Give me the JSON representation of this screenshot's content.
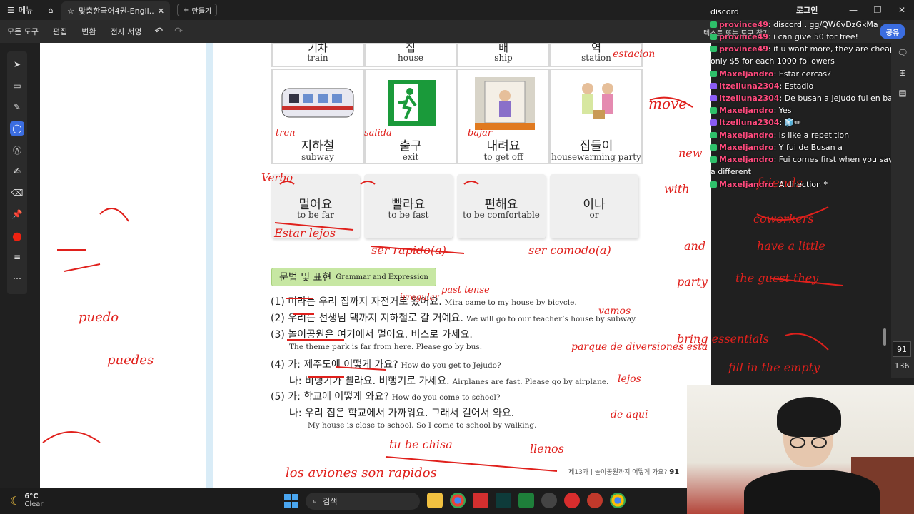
{
  "titlebar": {
    "menu_label": "메뉴",
    "tab_title": "맞춤한국어4권-Engli...",
    "new_tab_label": "만들기",
    "login_label": "로그인"
  },
  "toolbar": {
    "items": [
      "모든 도구",
      "편집",
      "변환",
      "전자 서명"
    ],
    "search_hint": "텍스트 또는 도구 찾기",
    "share_label": "공유"
  },
  "vocab_top": [
    {
      "ko": "기차",
      "en": "train"
    },
    {
      "ko": "집",
      "en": "house"
    },
    {
      "ko": "배",
      "en": "ship"
    },
    {
      "ko": "역",
      "en": "station"
    }
  ],
  "vocab_cards": [
    {
      "ko": "지하철",
      "en": "subway"
    },
    {
      "ko": "출구",
      "en": "exit"
    },
    {
      "ko": "내려요",
      "en": "to get off"
    },
    {
      "ko": "집들이",
      "en": "housewarming party"
    }
  ],
  "phrase_cards": [
    {
      "ko": "멀어요",
      "en": "to be far"
    },
    {
      "ko": "빨라요",
      "en": "to be fast"
    },
    {
      "ko": "편해요",
      "en": "to be comfortable"
    },
    {
      "ko": "이나",
      "en": "or"
    }
  ],
  "grammar": {
    "title": "문법 및 표현",
    "subtitle": "Grammar and Expression",
    "lines": [
      {
        "num": "(1)",
        "ko": "미라는 우리 집까지 자전거로 왔어요.",
        "en": "Mira came to my house by bicycle."
      },
      {
        "num": "(2)",
        "ko": "우리는 선생님 댁까지 지하철로 갈 거예요.",
        "en": "We will go to our teacher’s house by subway."
      },
      {
        "num": "(3)",
        "ko": "놀이공원은 여기에서 멀어요. 버스로 가세요.",
        "en": ""
      },
      {
        "num": "",
        "ko": "",
        "en": "The theme park is far from here.  Please go by bus."
      },
      {
        "num": "(4)",
        "ko": "가: 제주도에 어떻게 가요?",
        "en": "How do you get to Jejudo?"
      },
      {
        "num": "",
        "ko": "나: 비행기가 빨라요. 비행기로 가세요.",
        "en": "Airplanes are fast. Please go by airplane."
      },
      {
        "num": "(5)",
        "ko": "가: 학교에 어떻게 와요?",
        "en": "How do you come to school?"
      },
      {
        "num": "",
        "ko": "나: 우리 집은 학교에서 가까워요. 그래서 걸어서 와요.",
        "en": ""
      },
      {
        "num": "",
        "ko": "",
        "en": "My house is close to school.  So I come to school by walking."
      }
    ],
    "footer_text": "제13과 | 놀이공원까지 어떻게 가요?",
    "footer_page": "91"
  },
  "handwriting": {
    "annotations": [
      "Verbo",
      "Estar lejos",
      "ser rapido(a)",
      "ser comodo(a)",
      "tren",
      "salida",
      "bajar",
      "estacion",
      "move",
      "new",
      "with",
      "friends",
      "coworkers",
      "have a little",
      "the guest they",
      "and",
      "party",
      "bring essentials",
      "fill in the empty",
      "parque de diversiones esta",
      "lejos",
      "de aqui",
      "puedo",
      "puedes",
      "tu be chisa",
      "los aviones son rapidos",
      "llenos",
      "past tense",
      "irregular",
      "vamos"
    ]
  },
  "chat": {
    "messages": [
      {
        "user": "",
        "text": "discord",
        "badge": "none"
      },
      {
        "user": "province49",
        "text": "discord . gg/QW6vDzGkMa",
        "badge": "g"
      },
      {
        "user": "province49",
        "text": "i can give 50 for free!",
        "badge": "g"
      },
      {
        "user": "province49",
        "text": "if u want more, they are cheap! only $5 for each 1000 followers",
        "badge": "g"
      },
      {
        "user": "Maxeljandro",
        "text": "Estar cercas?",
        "badge": "g"
      },
      {
        "user": "Itzelluna2304",
        "text": "Estadio",
        "badge": "p"
      },
      {
        "user": "Itzelluna2304",
        "text": "De busan a jejudo fui en barco",
        "badge": "p"
      },
      {
        "user": "Maxeljandro",
        "text": "Yes",
        "badge": "g"
      },
      {
        "user": "Itzelluna2304",
        "text": "",
        "badge": "p"
      },
      {
        "user": "Maxeljandro",
        "text": "Is like a repetition",
        "badge": "g"
      },
      {
        "user": "Maxeljandro",
        "text": "Y fui de Busan a",
        "badge": "g"
      },
      {
        "user": "Maxeljandro",
        "text": "Fui comes first when you say a different",
        "badge": "g"
      },
      {
        "user": "Maxeljandro",
        "text": "A direction *",
        "badge": "g"
      }
    ]
  },
  "viewer": {
    "current_page": "91",
    "total_pages": "136"
  },
  "taskbar": {
    "temp": "6°C",
    "condition": "Clear",
    "search_label": "검색"
  },
  "colors": {
    "ink": "#e0201c",
    "accent": "#3b6de0",
    "grammar_bg": "#c7e7a3",
    "highlight": "#c6862c"
  }
}
